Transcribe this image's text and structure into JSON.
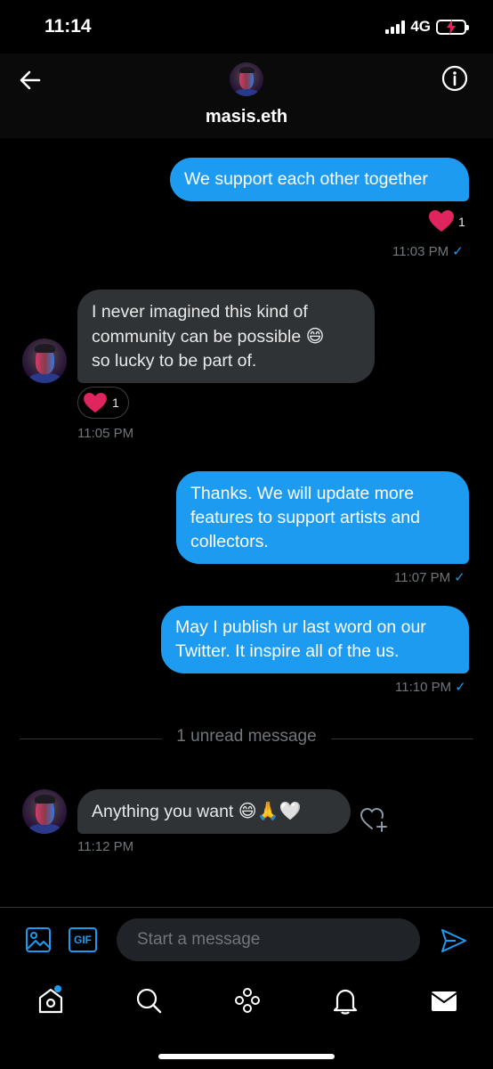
{
  "status": {
    "time": "11:14",
    "network": "4G"
  },
  "header": {
    "name": "masis.eth"
  },
  "messages": {
    "m1": {
      "text": "We support each other together",
      "reaction_count": "1",
      "time": "11:03 PM"
    },
    "m2": {
      "text_line1": "I never imagined this kind of",
      "text_line2": "community can be possible",
      "text_line3": "so lucky to be part of.",
      "reaction_count": "1",
      "time": "11:05 PM"
    },
    "m3": {
      "text_line1": "Thanks. We will update more",
      "text_line2": "features to support artists and",
      "text_line3": "collectors.",
      "time": "11:07 PM"
    },
    "m4": {
      "text_line1": "May I publish ur last word on our",
      "text_line2": "Twitter. It inspire all of the us.",
      "time": "11:10 PM"
    },
    "m5": {
      "text": "Anything you want",
      "time": "11:12 PM"
    }
  },
  "divider": {
    "label": "1 unread message"
  },
  "composer": {
    "placeholder": "Start a message",
    "gif_label": "GIF"
  },
  "icons": [
    "back-arrow-icon",
    "info-icon",
    "heart-icon",
    "image-icon",
    "gif-icon",
    "send-icon",
    "home-icon",
    "search-icon",
    "spaces-icon",
    "bell-icon",
    "mail-icon",
    "add-reaction-icon"
  ],
  "colors": {
    "accent": "#1d9bf0",
    "incoming_bubble": "#2f3336",
    "heart": "#e0245e",
    "background": "#000000"
  }
}
